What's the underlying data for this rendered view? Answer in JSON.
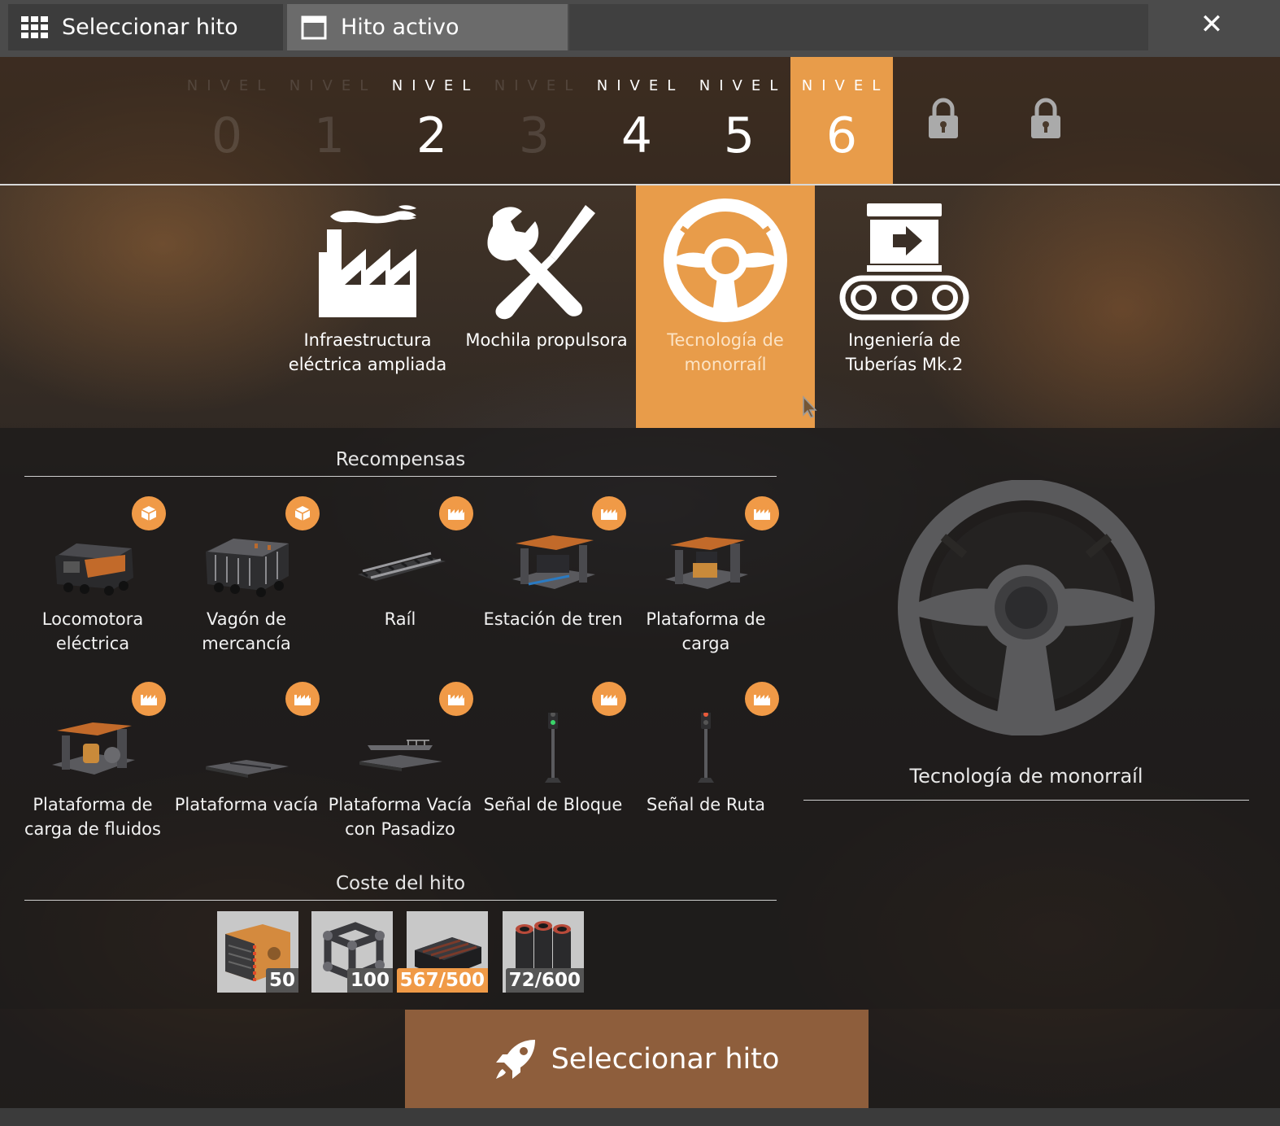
{
  "window": {
    "tabs": [
      {
        "label": "Seleccionar hito",
        "icon": "grid-icon"
      },
      {
        "label": "Hito activo",
        "icon": "window-icon"
      }
    ],
    "close_icon": "close-icon"
  },
  "tiers": {
    "label": "NIVEL",
    "items": [
      {
        "number": "0",
        "state": "dim"
      },
      {
        "number": "1",
        "state": "dim"
      },
      {
        "number": "2",
        "state": "available"
      },
      {
        "number": "3",
        "state": "dim"
      },
      {
        "number": "4",
        "state": "available"
      },
      {
        "number": "5",
        "state": "available"
      },
      {
        "number": "6",
        "state": "selected"
      }
    ],
    "locked_count": 2
  },
  "schematics": [
    {
      "name": "Infraestructura eléctrica ampliada",
      "icon": "factory-icon"
    },
    {
      "name": "Mochila propulsora",
      "icon": "tools-icon"
    },
    {
      "name": "Tecnología de monorraíl",
      "icon": "steering-wheel-icon",
      "selected": true
    },
    {
      "name": "Ingeniería de Tuberías Mk.2",
      "icon": "conveyor-icon"
    }
  ],
  "rewards": {
    "title": "Recompensas",
    "items": [
      {
        "name": "Locomotora eléctrica",
        "badge": "vehicle-badge-icon"
      },
      {
        "name": "Vagón de mercancía",
        "badge": "vehicle-badge-icon"
      },
      {
        "name": "Raíl",
        "badge": "building-badge-icon"
      },
      {
        "name": "Estación de tren",
        "badge": "building-badge-icon"
      },
      {
        "name": "Plataforma de carga",
        "badge": "building-badge-icon"
      },
      {
        "name": "Plataforma de carga de fluidos",
        "badge": "building-badge-icon"
      },
      {
        "name": "Plataforma vacía",
        "badge": "building-badge-icon"
      },
      {
        "name": "Plataforma Vacía con Pasadizo",
        "badge": "building-badge-icon"
      },
      {
        "name": "Señal de Bloque",
        "badge": "building-badge-icon"
      },
      {
        "name": "Señal de Ruta",
        "badge": "building-badge-icon"
      }
    ]
  },
  "cost": {
    "title": "Coste del hito",
    "items": [
      {
        "amount": "50",
        "satisfied": false
      },
      {
        "amount": "100",
        "satisfied": false
      },
      {
        "amount": "567/500",
        "satisfied": true
      },
      {
        "amount": "72/600",
        "satisfied": false
      }
    ]
  },
  "preview": {
    "name": "Tecnología de monorraíl",
    "icon": "steering-wheel-icon"
  },
  "action": {
    "label": "Seleccionar hito",
    "icon": "rocket-icon"
  },
  "colors": {
    "accent": "#e89c4a",
    "badge": "#f09a47",
    "button": "#8e5e3c"
  }
}
